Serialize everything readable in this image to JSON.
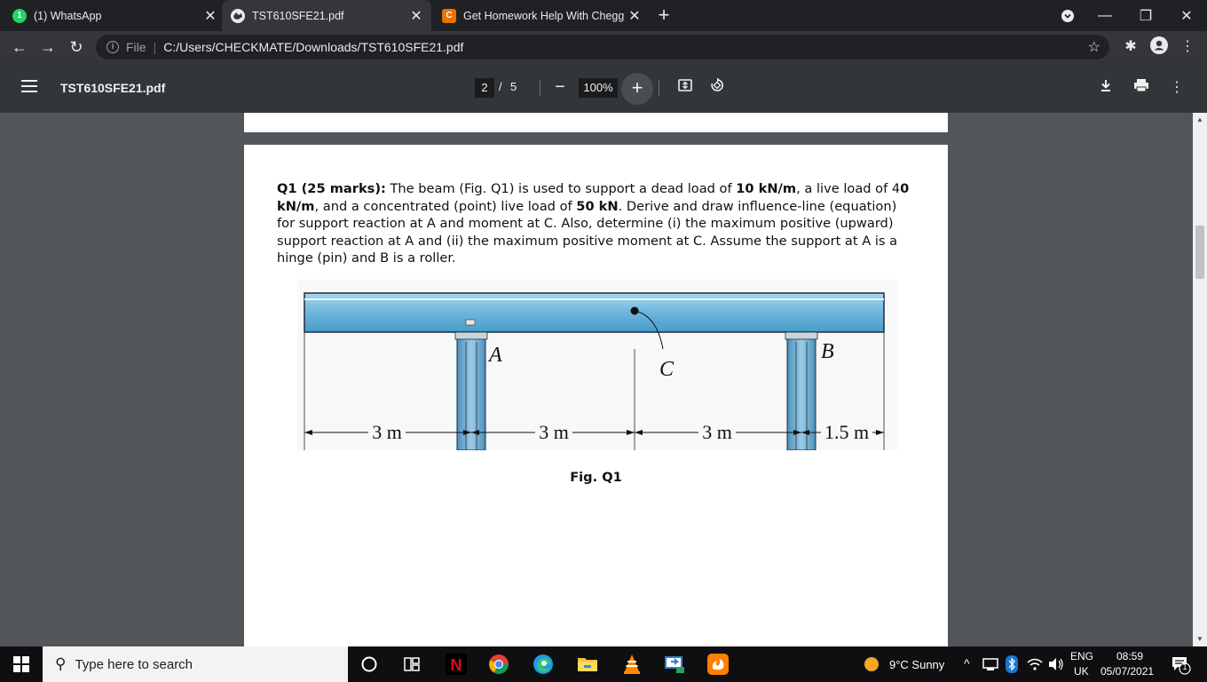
{
  "browser": {
    "tabs": [
      {
        "title": "(1) WhatsApp",
        "favicon": "whatsapp-icon",
        "favicon_text": "1",
        "color": "#25d366",
        "active": false
      },
      {
        "title": "TST610SFE21.pdf",
        "favicon": "globe-icon",
        "favicon_text": "",
        "color": "#e8eaed",
        "active": true
      },
      {
        "title": "Get Homework Help With Chegg",
        "favicon": "chegg-icon",
        "favicon_text": "C",
        "color": "#eb7100",
        "active": false
      }
    ],
    "address": {
      "scheme_label": "File",
      "url": "C:/Users/CHECKMATE/Downloads/TST610SFE21.pdf"
    }
  },
  "pdf": {
    "title": "TST610SFE21.pdf",
    "current_page": "2",
    "page_sep": "/",
    "total_pages": "5",
    "zoom": "100%"
  },
  "document": {
    "question_label": "Q1 (25 marks):",
    "q_text_1": " The beam (Fig. Q1) is used to support a dead load of ",
    "dead_load": "10 kN/m",
    "q_text_2": ", a live load of 4",
    "live_load_bold": "0 kN/m",
    "q_text_3": ", and a concentrated (point) live load of ",
    "point_load": "50 kN",
    "q_text_4": ". Derive and draw influence-line (equation) for support reaction at A and moment at C. Also, determine (i) the maximum positive (upward) support reaction at A and (ii) the maximum positive moment at C. Assume the support at A is a hinge (pin) and B is a roller.",
    "figure": {
      "label_a": "A",
      "label_b": "B",
      "label_c": "C",
      "dim_1": "3 m",
      "dim_2": "3 m",
      "dim_3": "3 m",
      "dim_4": "1.5 m"
    },
    "caption": "Fig. Q1"
  },
  "taskbar": {
    "search_placeholder": "Type here to search",
    "weather": "9°C  Sunny",
    "lang_1": "ENG",
    "lang_2": "UK",
    "time": "08:59",
    "date": "05/07/2021",
    "notification_count": "1"
  }
}
